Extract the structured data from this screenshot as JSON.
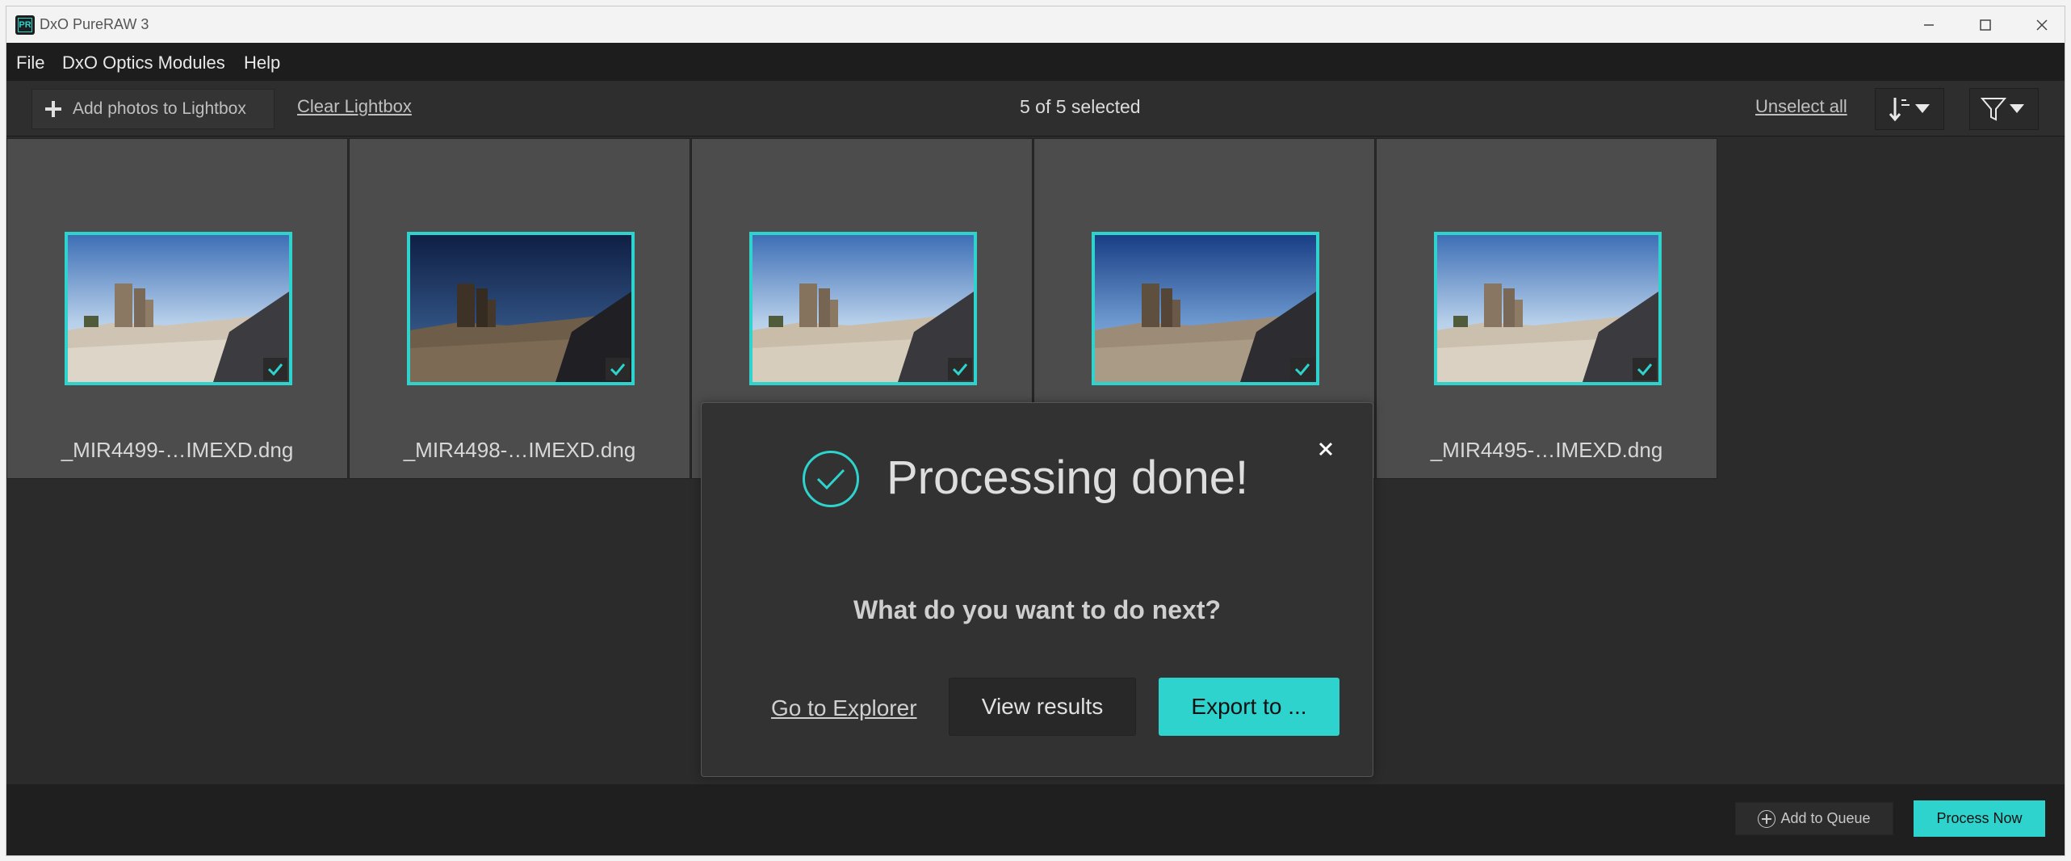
{
  "window": {
    "title": "DxO PureRAW 3",
    "app_icon_text": "PR"
  },
  "menu": {
    "items": [
      "File",
      "DxO Optics Modules",
      "Help"
    ]
  },
  "toolbar": {
    "add_label": "Add photos to Lightbox",
    "clear_label": "Clear Lightbox",
    "selection_text": "5 of 5 selected",
    "unselect_label": "Unselect all"
  },
  "thumbnails": [
    {
      "name": "_MIR4499-…IMEXD.dng",
      "selected": true,
      "sky": "light"
    },
    {
      "name": "_MIR4498-…IMEXD.dng",
      "selected": true,
      "sky": "dark"
    },
    {
      "name": "",
      "selected": true,
      "sky": "light"
    },
    {
      "name": "",
      "selected": true,
      "sky": "mid"
    },
    {
      "name": "_MIR4495-…IMEXD.dng",
      "selected": true,
      "sky": "light"
    }
  ],
  "modal": {
    "title": "Processing done!",
    "question": "What do you want to do next?",
    "explorer_label": "Go to Explorer",
    "view_label": "View results",
    "export_label": "Export to ..."
  },
  "bottombar": {
    "queue_label": "Add to Queue",
    "process_label": "Process Now"
  },
  "colors": {
    "accent": "#2fd3cd",
    "background": "#2b2b2b",
    "menubar": "#1d1d1d",
    "thumbnail_bg": "#4c4c4c"
  }
}
